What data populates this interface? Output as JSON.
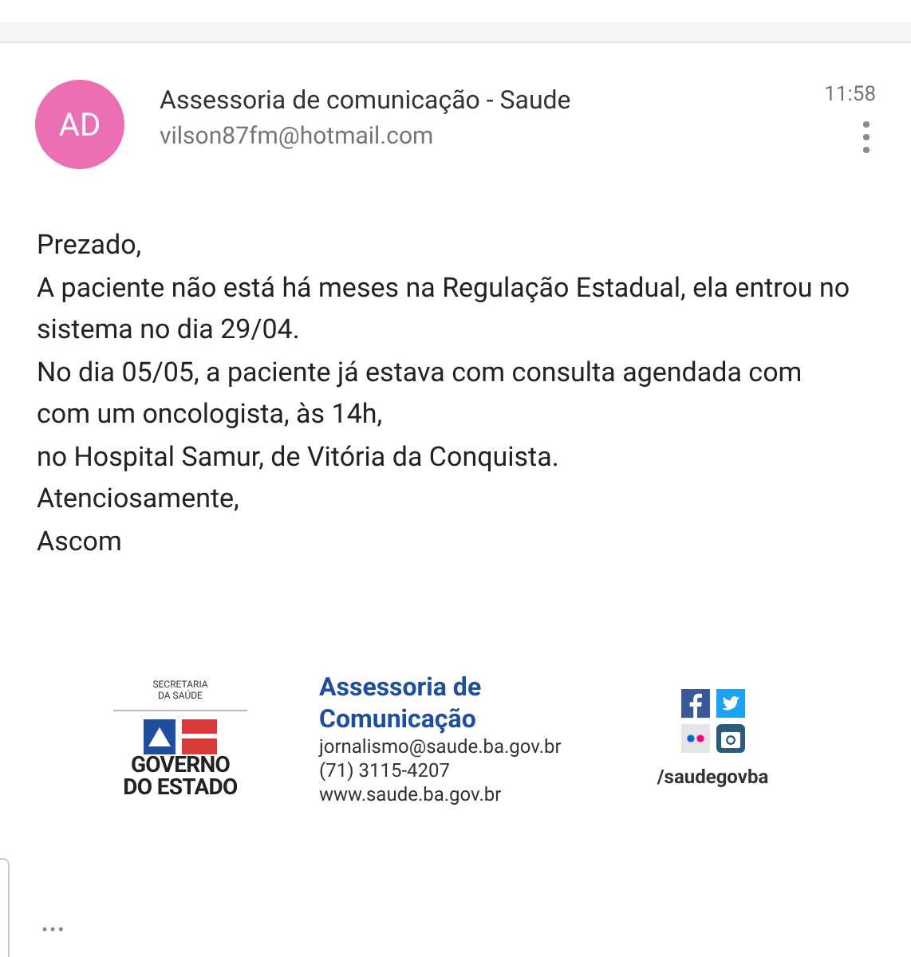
{
  "sender": {
    "initials": "AD",
    "name": "Assessoria de comunicação - Saude",
    "email": "vilson87fm@hotmail.com",
    "time": "11:58"
  },
  "body": [
    "Prezado,",
    "A paciente não está há meses na Regulação Estadual, ela entrou no sistema no dia 29/04.",
    "No dia 05/05, a paciente já estava com consulta agendada com com um oncologista, às 14h,",
    "no Hospital Samur, de Vitória da Conquista.",
    "Atenciosamente,",
    "Ascom"
  ],
  "signature": {
    "logo_top": [
      "SECRETARIA",
      "DA SAÚDE"
    ],
    "logo_bottom": [
      "GOVERNO",
      "DO ESTADO"
    ],
    "title": [
      "Assessoria de",
      "Comunicação"
    ],
    "contacts": [
      "jornalismo@saude.ba.gov.br",
      "(71) 3115-4207",
      "www.saude.ba.gov.br"
    ],
    "social_handle": "/saudegovba"
  },
  "more": "•••"
}
